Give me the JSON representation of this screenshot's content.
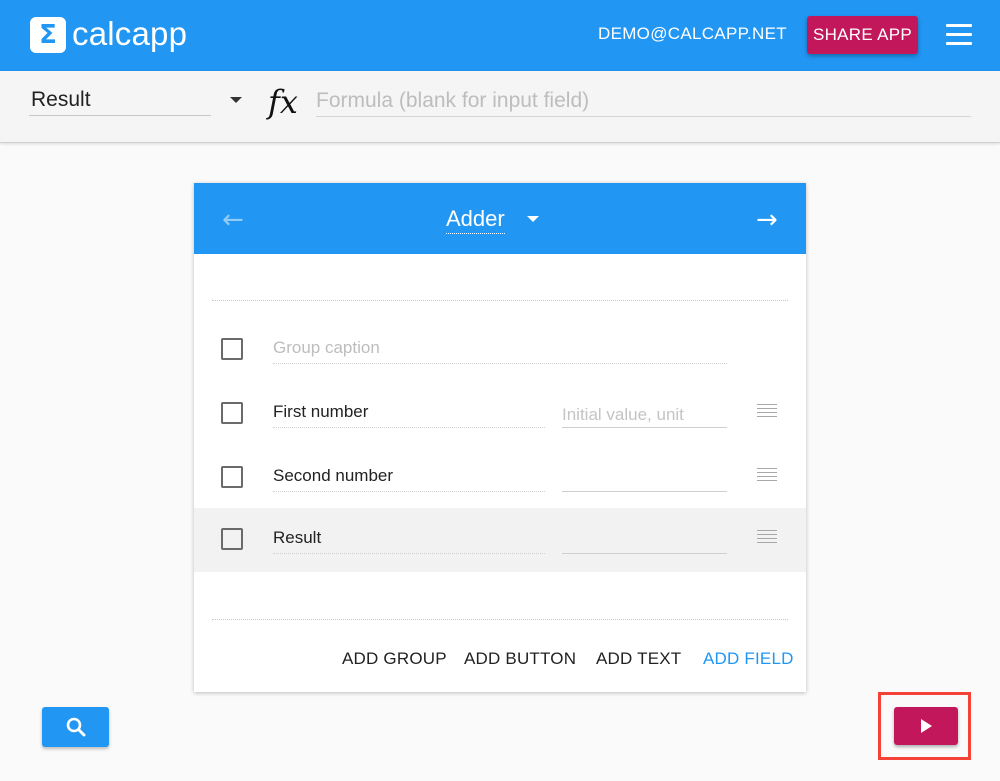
{
  "app": {
    "brand": "calcapp",
    "logo_symbol": "Σ",
    "account_email": "DEMO@CALCAPP.NET",
    "share_label": "SHARE APP"
  },
  "formula_bar": {
    "selected_field": "Result",
    "fx_symbol": "fx",
    "formula_placeholder": "Formula (blank for input field)",
    "formula_value": ""
  },
  "screen": {
    "title": "Adder",
    "prev_arrow": "←",
    "next_arrow": "→"
  },
  "rows": [
    {
      "label": "Group caption",
      "is_placeholder": true
    },
    {
      "label": "First number",
      "value": "",
      "value_placeholder": "Initial value, unit"
    },
    {
      "label": "Second number",
      "value": "",
      "value_placeholder": ""
    },
    {
      "label": "Result",
      "value": "",
      "value_placeholder": "",
      "selected": true
    }
  ],
  "actions": {
    "add_group": "ADD GROUP",
    "add_button": "ADD BUTTON",
    "add_text": "ADD TEXT",
    "add_field": "ADD FIELD"
  },
  "icons": {
    "search": "search-icon",
    "play": "play-icon",
    "menu": "hamburger-menu-icon",
    "drag": "drag-handle-icon"
  },
  "colors": {
    "primary": "#2196f3",
    "accent": "#c2185b",
    "highlight_border": "#f44336"
  }
}
